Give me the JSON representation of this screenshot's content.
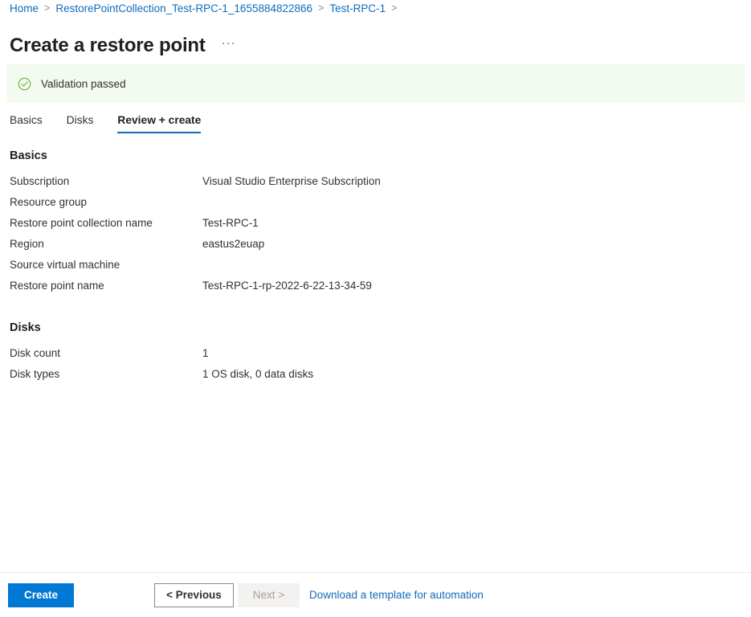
{
  "breadcrumb": {
    "items": [
      {
        "label": "Home"
      },
      {
        "label": "RestorePointCollection_Test-RPC-1_1655884822866"
      },
      {
        "label": "Test-RPC-1"
      }
    ],
    "separator": ">"
  },
  "header": {
    "title": "Create a restore point",
    "more_menu": "···"
  },
  "validation": {
    "message": "Validation passed",
    "icon": "check-circle-icon",
    "background_color": "#f3faef",
    "icon_color": "#5ea82e"
  },
  "tabs": [
    {
      "label": "Basics",
      "active": false
    },
    {
      "label": "Disks",
      "active": false
    },
    {
      "label": "Review + create",
      "active": true
    }
  ],
  "sections": [
    {
      "heading": "Basics",
      "rows": [
        {
          "label": "Subscription",
          "value": "Visual Studio Enterprise Subscription"
        },
        {
          "label": "Resource group",
          "value": ""
        },
        {
          "label": "Restore point collection name",
          "value": "Test-RPC-1"
        },
        {
          "label": "Region",
          "value": "eastus2euap"
        },
        {
          "label": "Source virtual machine",
          "value": ""
        },
        {
          "label": "Restore point name",
          "value": "Test-RPC-1-rp-2022-6-22-13-34-59"
        }
      ]
    },
    {
      "heading": "Disks",
      "rows": [
        {
          "label": "Disk count",
          "value": "1"
        },
        {
          "label": "Disk types",
          "value": "1 OS disk, 0 data disks"
        }
      ]
    }
  ],
  "footer": {
    "create_label": "Create",
    "previous_label": "< Previous",
    "next_label": "Next >",
    "next_disabled": true,
    "download_template_label": "Download a template for automation"
  },
  "colors": {
    "accent": "#0078d4",
    "link": "#0f6cbd",
    "success": "#5ea82e",
    "text": "#323130"
  }
}
